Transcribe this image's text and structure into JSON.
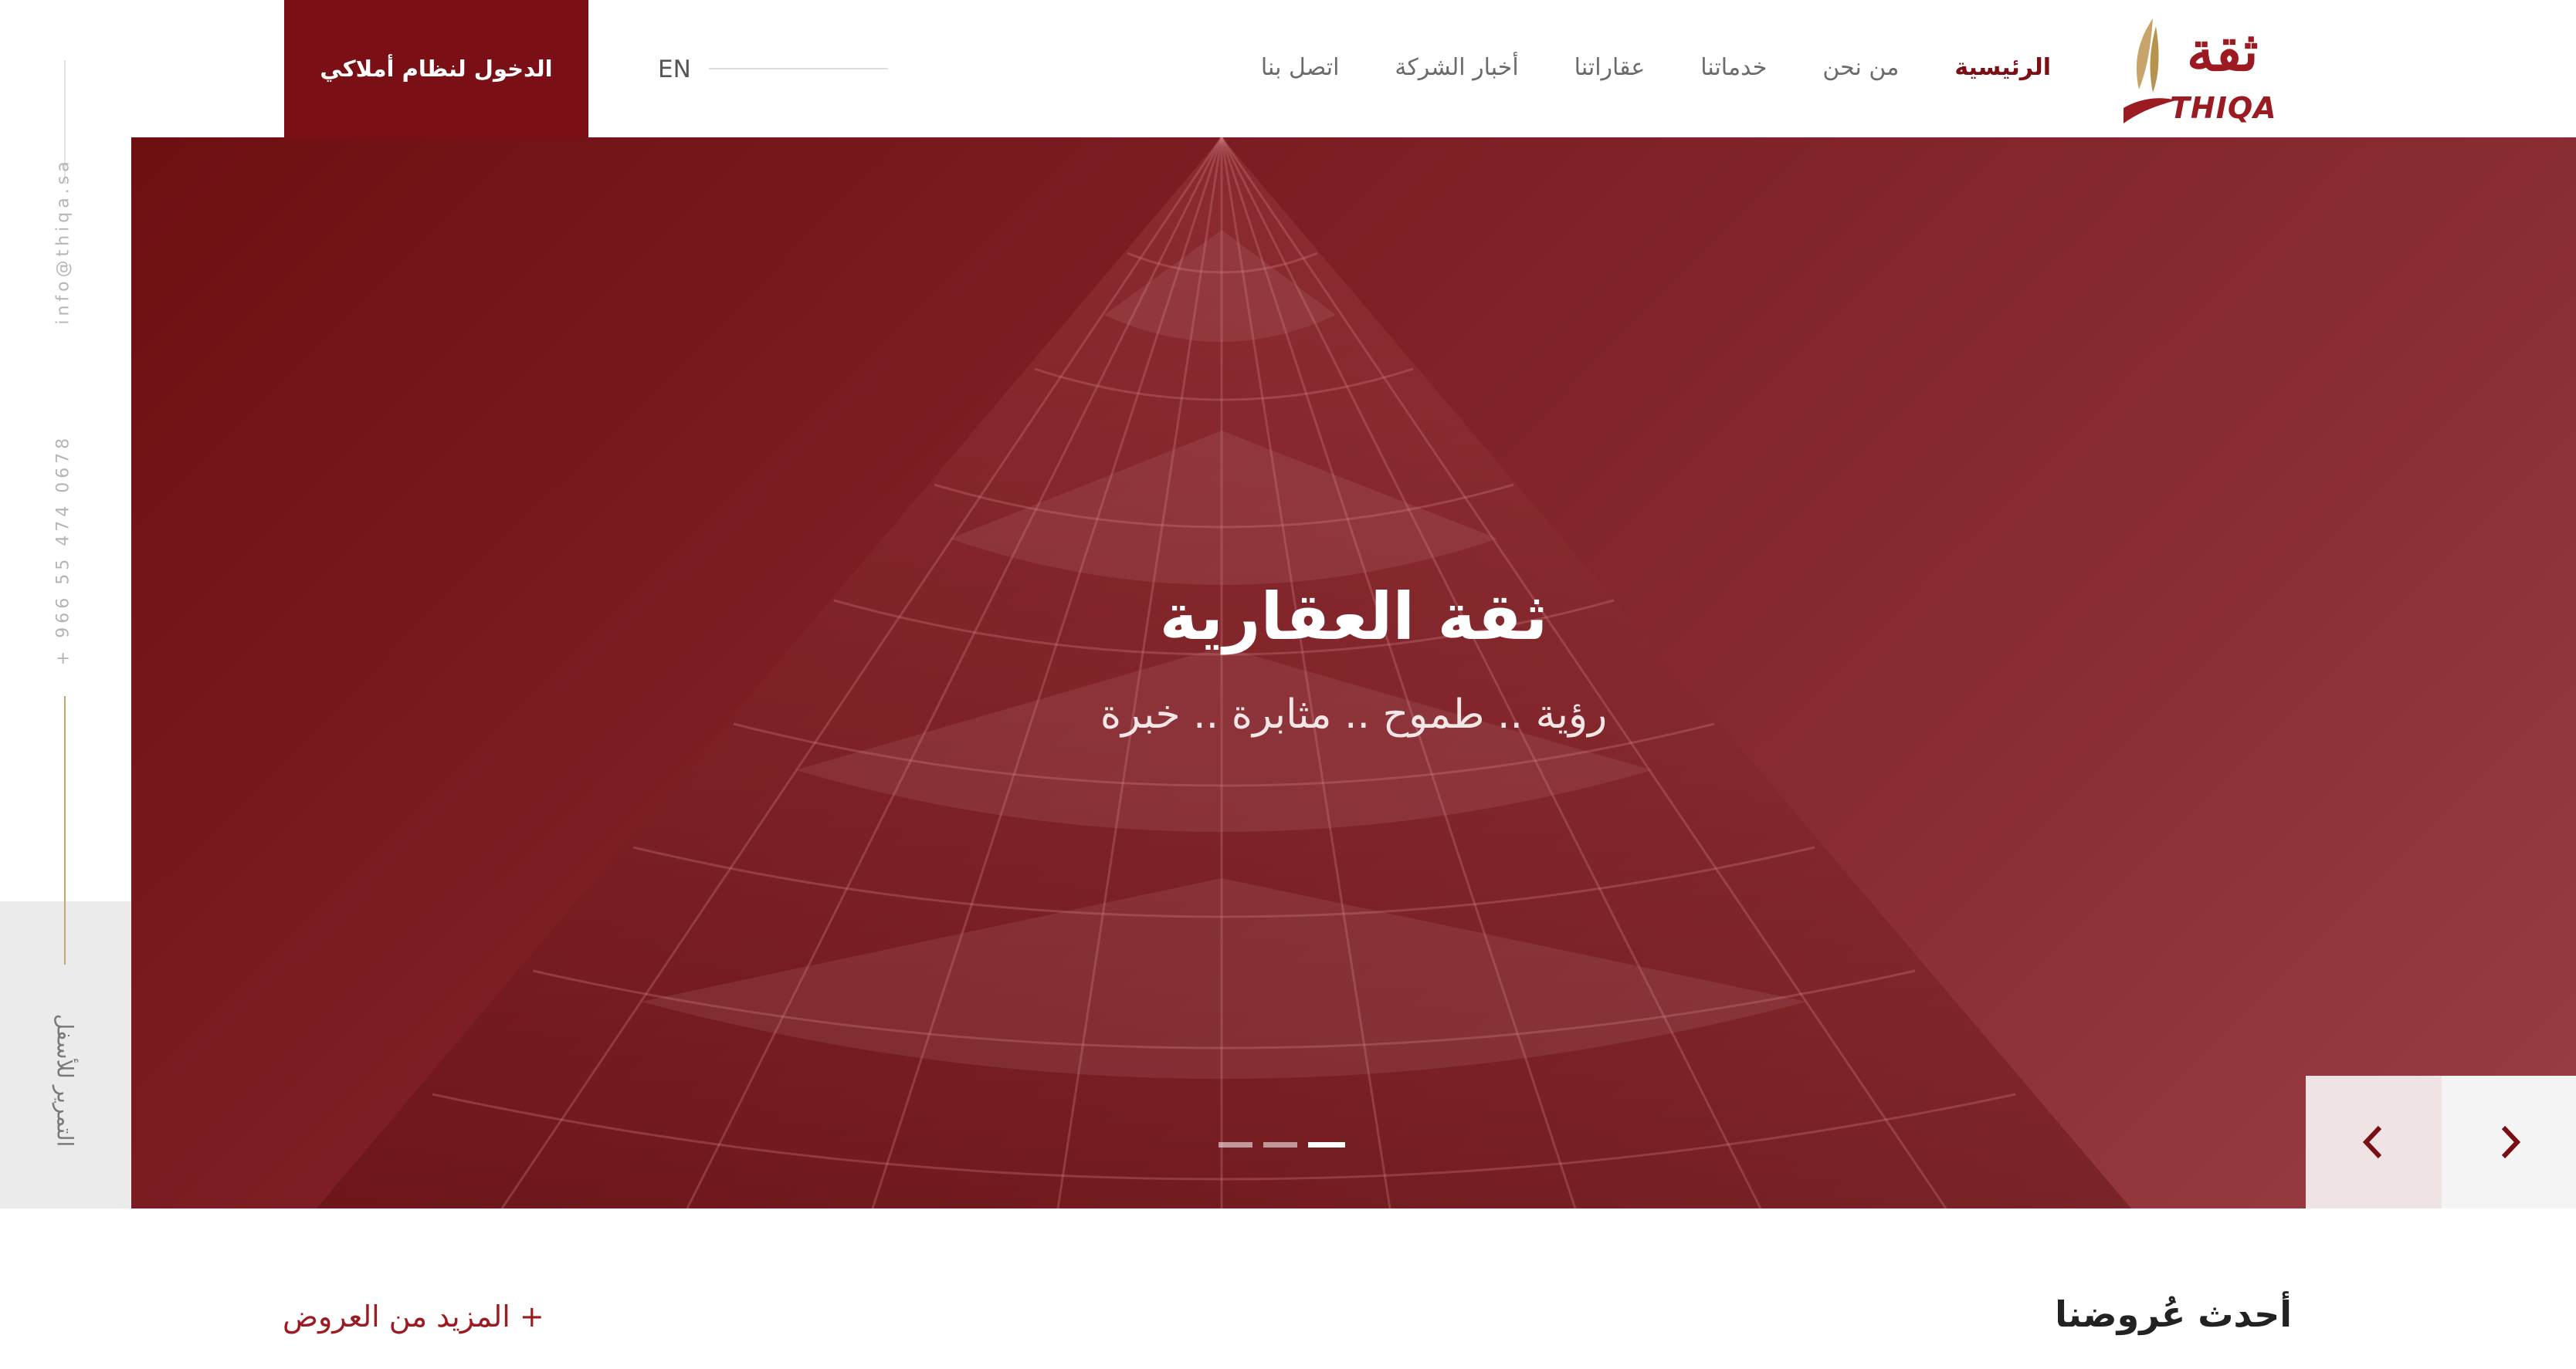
{
  "header": {
    "login_label": "الدخول لنظام أملاكي",
    "lang_label": "EN",
    "nav": [
      {
        "label": "الرئيسية",
        "active": true
      },
      {
        "label": "من نحن",
        "active": false
      },
      {
        "label": "خدماتنا",
        "active": false
      },
      {
        "label": "عقاراتنا",
        "active": false
      },
      {
        "label": "أخبار الشركة",
        "active": false
      },
      {
        "label": "اتصل بنا",
        "active": false
      }
    ],
    "logo_ar": "ثقة",
    "logo_en": "THIQA"
  },
  "rail": {
    "email": "info@thiqa.sa",
    "phone": "+ 966 55 474 0678",
    "scroll_label": "التمرير للأسفل"
  },
  "hero": {
    "title": "ثقة العقارية",
    "subtitle": "رؤية .. طموح .. مثابرة .. خبرة",
    "slides_count": 3,
    "active_slide": 3
  },
  "section": {
    "title": "أحدث عُروضنا",
    "more_label": "+ المزيد من العروض"
  },
  "colors": {
    "brand": "#7a1016",
    "accent_gold": "#c8a46a",
    "hero_overlay": "#7c1e23"
  }
}
